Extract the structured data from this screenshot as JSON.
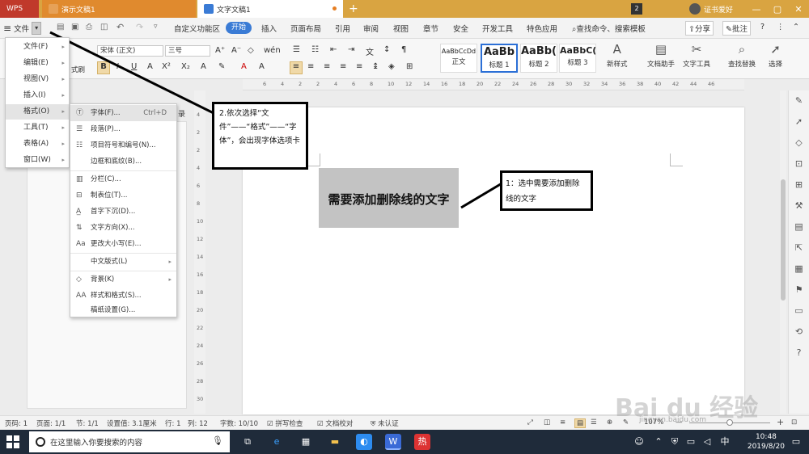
{
  "titlebar": {
    "tabs": [
      {
        "label": "WPS",
        "color": "#c0392b"
      },
      {
        "label": "演示文稿1",
        "color": "#e08a2e"
      },
      {
        "label": "文字文稿1",
        "color": "#ffffff"
      }
    ],
    "badge": "2",
    "account": "证书爱好"
  },
  "menubar": {
    "file": "文件",
    "tabs": [
      "自定义功能区",
      "开始",
      "插入",
      "页面布局",
      "引用",
      "审阅",
      "视图",
      "章节",
      "安全",
      "开发工具",
      "特色应用"
    ],
    "active_tab": "开始",
    "search": "查找命令、搜索模板",
    "share": "分享",
    "comment": "批注"
  },
  "ribbon": {
    "paste_hint": "式刷",
    "font_name": "宋体 (正文)",
    "font_size": "三号",
    "styles": [
      {
        "preview": "AaBbCcDd",
        "label": "正文"
      },
      {
        "preview": "AaBb",
        "label": "标题 1"
      },
      {
        "preview": "AaBb(",
        "label": "标题 2"
      },
      {
        "preview": "AaBbC(",
        "label": "标题 3"
      }
    ],
    "new_style": "新样式",
    "writing_assistant": "文档助手",
    "text_tools": "文字工具",
    "find_replace": "查找替换",
    "select": "选择"
  },
  "ruler": {
    "h_ticks": [
      "6",
      "4",
      "2",
      "2",
      "4",
      "6",
      "8",
      "10",
      "12",
      "14",
      "16",
      "18",
      "20",
      "22",
      "24",
      "26",
      "28",
      "30",
      "32",
      "34",
      "36",
      "38",
      "40",
      "42",
      "44",
      "46"
    ],
    "v_ticks": [
      "4",
      "2",
      "2",
      "4",
      "6",
      "8",
      "10",
      "12",
      "14",
      "16",
      "18",
      "20",
      "22",
      "24",
      "26",
      "28",
      "30"
    ]
  },
  "nav_hint": "录",
  "file_menu": {
    "items": [
      {
        "label": "文件(F)",
        "active": false
      },
      {
        "label": "编辑(E)",
        "active": false
      },
      {
        "label": "视图(V)",
        "active": false
      },
      {
        "label": "插入(I)",
        "active": false
      },
      {
        "label": "格式(O)",
        "active": true
      },
      {
        "label": "工具(T)",
        "active": false
      },
      {
        "label": "表格(A)",
        "active": false
      },
      {
        "label": "窗口(W)",
        "active": false
      }
    ]
  },
  "format_menu": {
    "items": [
      {
        "label": "字体(F)...",
        "shortcut": "Ctrl+D",
        "icon": "font-icon"
      },
      {
        "label": "段落(P)...",
        "icon": "paragraph-icon"
      },
      {
        "label": "项目符号和编号(N)...",
        "icon": "bullets-icon"
      },
      {
        "label": "边框和底纹(B)...",
        "icon": ""
      },
      {
        "label": "分栏(C)...",
        "icon": "columns-icon"
      },
      {
        "label": "制表位(T)...",
        "icon": "tab-stop-icon"
      },
      {
        "label": "首字下沉(D)...",
        "icon": "drop-cap-icon"
      },
      {
        "label": "文字方向(X)...",
        "icon": "text-direction-icon"
      },
      {
        "label": "更改大小写(E)...",
        "icon": "change-case-icon"
      },
      {
        "label": "中文版式(L)",
        "icon": ""
      },
      {
        "label": "背景(K)",
        "icon": "background-icon"
      },
      {
        "label": "样式和格式(S)...",
        "icon": "styles-icon"
      },
      {
        "label": "稿纸设置(G)...",
        "icon": ""
      }
    ]
  },
  "document": {
    "selected_text": "需要添加删除线的文字"
  },
  "callouts": {
    "step2": "2.依次选择“文件”——“格式”——“字体”，会出现字体选项卡",
    "step1": "1：选中需要添加删除线的文字"
  },
  "statusbar": {
    "page_num": "页码: 1",
    "pages": "页面: 1/1",
    "section": "节: 1/1",
    "setting": "设置值: 3.1厘米",
    "row": "行: 1",
    "col": "列: 12",
    "words": "字数: 10/10",
    "spell": "拼写检查",
    "proof": "文档校对",
    "auth": "未认证",
    "zoom": "107%"
  },
  "taskbar": {
    "search_placeholder": "在这里输入你要搜索的内容",
    "time": "10:48",
    "date": "2019/8/20",
    "ime": "中"
  },
  "watermark": {
    "logo": "Bai du 经验",
    "url": "jingyan.baidu.com"
  }
}
